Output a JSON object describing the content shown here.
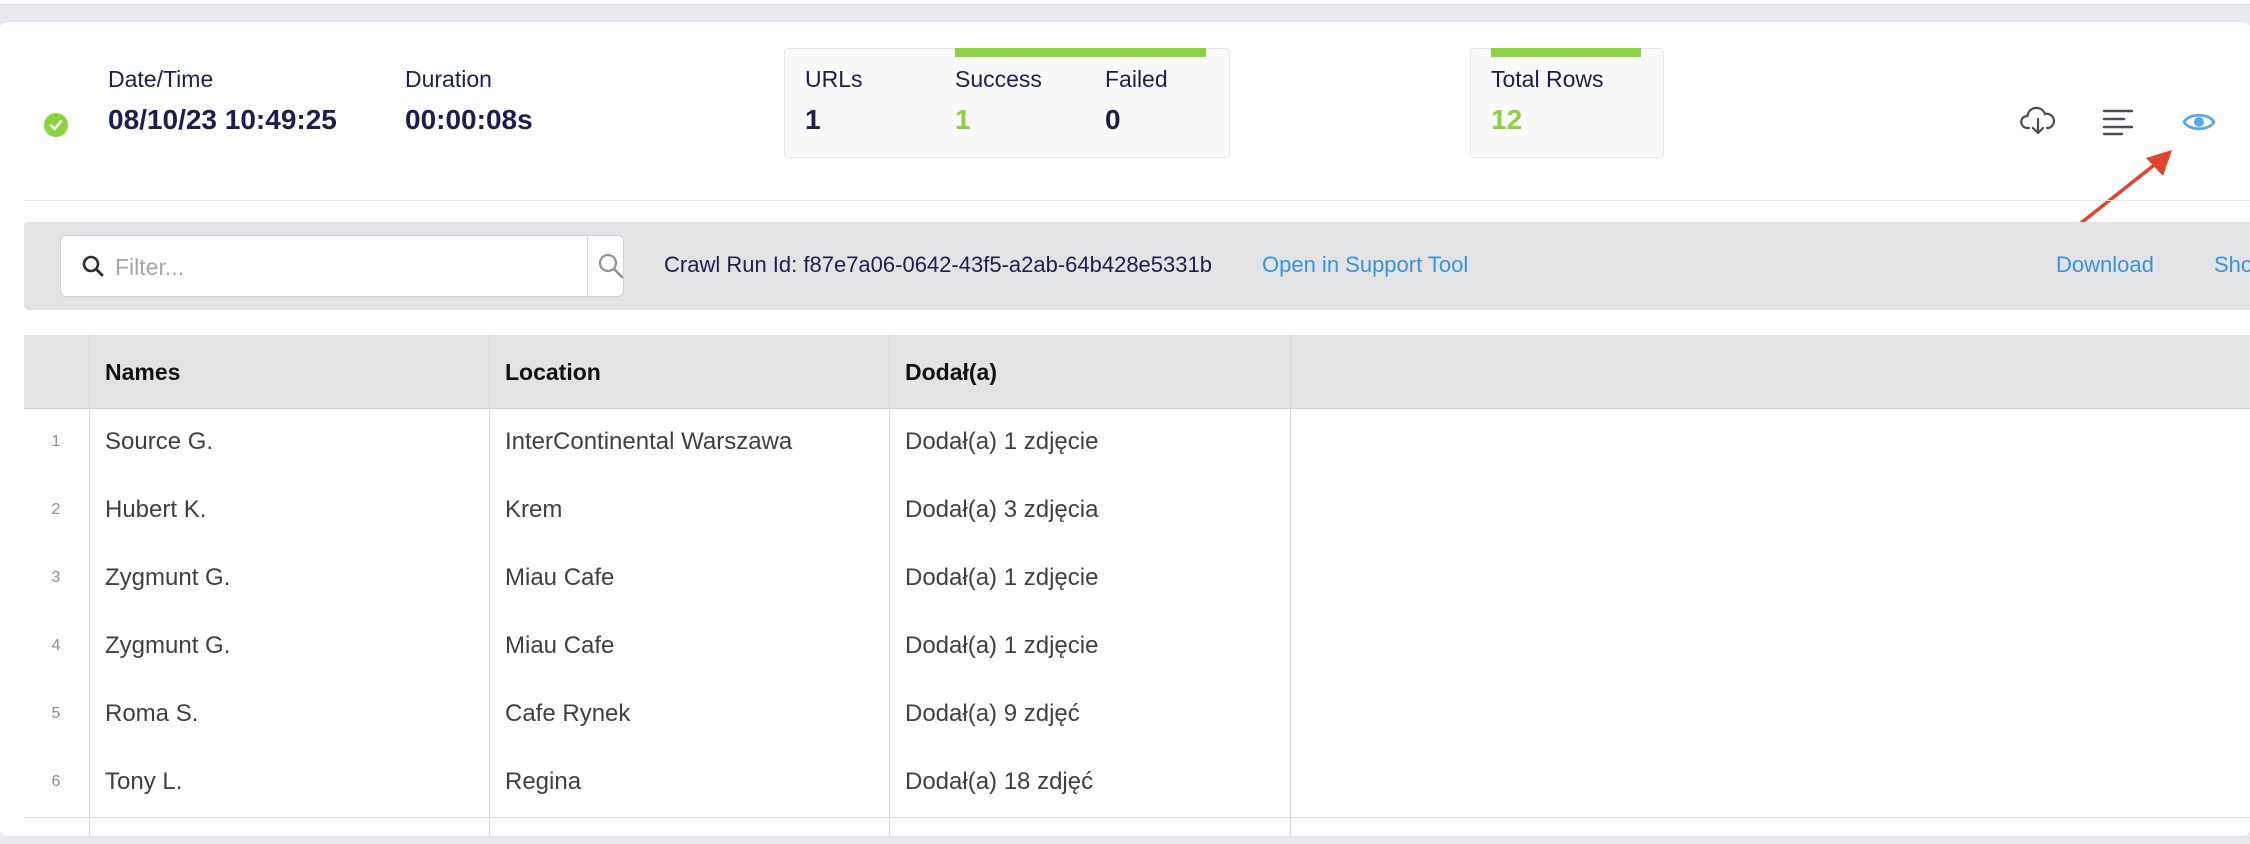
{
  "stats": {
    "datetime_label": "Date/Time",
    "datetime_value": "08/10/23 10:49:25",
    "duration_label": "Duration",
    "duration_value": "00:00:08s",
    "urls_label": "URLs",
    "urls_value": "1",
    "success_label": "Success",
    "success_value": "1",
    "failed_label": "Failed",
    "failed_value": "0",
    "total_rows_label": "Total Rows",
    "total_rows_value": "12"
  },
  "header_icons": [
    "cloud-download-icon",
    "align-left-icon",
    "eye-icon"
  ],
  "toolbar": {
    "filter_placeholder": "Filter...",
    "crawl_run_text": "Crawl Run Id: f87e7a06-0642-43f5-a2ab-64b428e5331b",
    "support_link": "Open in Support Tool",
    "download_link": "Download",
    "show_link": "Sho"
  },
  "table": {
    "columns": [
      "Names",
      "Location",
      "Dodał(a)"
    ],
    "rows": [
      {
        "num": "1",
        "name": "Source G.",
        "location": "InterContinental Warszawa",
        "added": "Dodał(a) 1 zdjęcie"
      },
      {
        "num": "2",
        "name": "Hubert K.",
        "location": "Krem",
        "added": "Dodał(a) 3 zdjęcia"
      },
      {
        "num": "3",
        "name": "Zygmunt G.",
        "location": "Miau Cafe",
        "added": "Dodał(a) 1 zdjęcie"
      },
      {
        "num": "4",
        "name": "Zygmunt G.",
        "location": "Miau Cafe",
        "added": "Dodał(a) 1 zdjęcie"
      },
      {
        "num": "5",
        "name": "Roma S.",
        "location": "Cafe Rynek",
        "added": "Dodał(a) 9 zdjęć"
      },
      {
        "num": "6",
        "name": "Tony L.",
        "location": "Regina",
        "added": "Dodał(a) 18 zdjęć"
      }
    ]
  },
  "colors": {
    "accent_green": "#8cd13f",
    "link_blue": "#3b93d6",
    "eye_blue": "#59a9e8",
    "arrow_red": "#e0442e",
    "text_navy": "#1b1f4a"
  }
}
